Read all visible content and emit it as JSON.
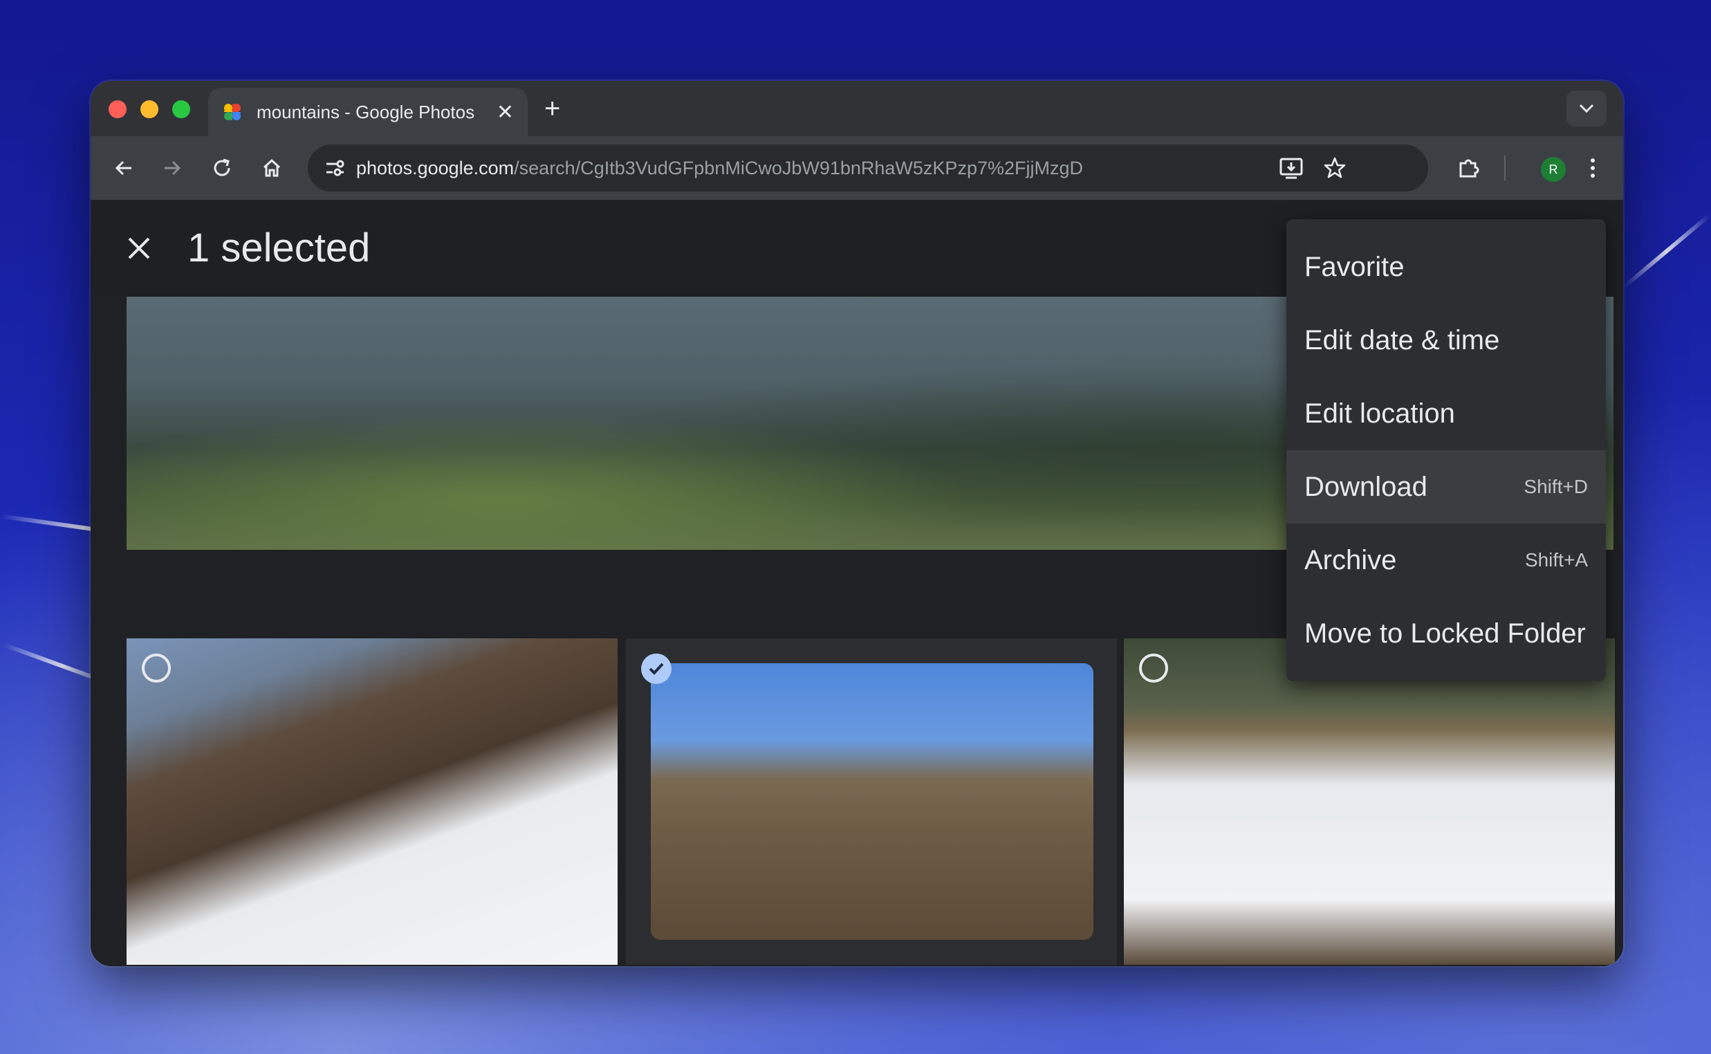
{
  "browser": {
    "tab_title": "mountains - Google Photos",
    "url_host": "photos.google.com",
    "url_path": "/search/CgItb3VudGFpbnMiCwoJbW91bnRhaW5zKPzp7%2FjjMzgD",
    "profile_initial": "R"
  },
  "selection": {
    "title": "1 selected"
  },
  "menu": {
    "items": [
      {
        "label": "Favorite",
        "shortcut": ""
      },
      {
        "label": "Edit date & time",
        "shortcut": ""
      },
      {
        "label": "Edit location",
        "shortcut": ""
      },
      {
        "label": "Download",
        "shortcut": "Shift+D"
      },
      {
        "label": "Archive",
        "shortcut": "Shift+A"
      },
      {
        "label": "Move to Locked Folder",
        "shortcut": ""
      }
    ]
  },
  "photos": [
    {
      "name": "forest-panorama",
      "selected": false
    },
    {
      "name": "snowy-slope",
      "selected": false
    },
    {
      "name": "hikers-sitting",
      "selected": true
    },
    {
      "name": "hiking-group",
      "selected": false
    },
    {
      "name": "forest-bottom-1",
      "selected": false
    },
    {
      "name": "forest-bottom-2",
      "selected": false
    },
    {
      "name": "forest-bottom-3",
      "selected": false
    }
  ],
  "colors": {
    "accent_check": "#aecbfa",
    "menu_bg": "#2d2e31",
    "page_bg": "#202124"
  }
}
